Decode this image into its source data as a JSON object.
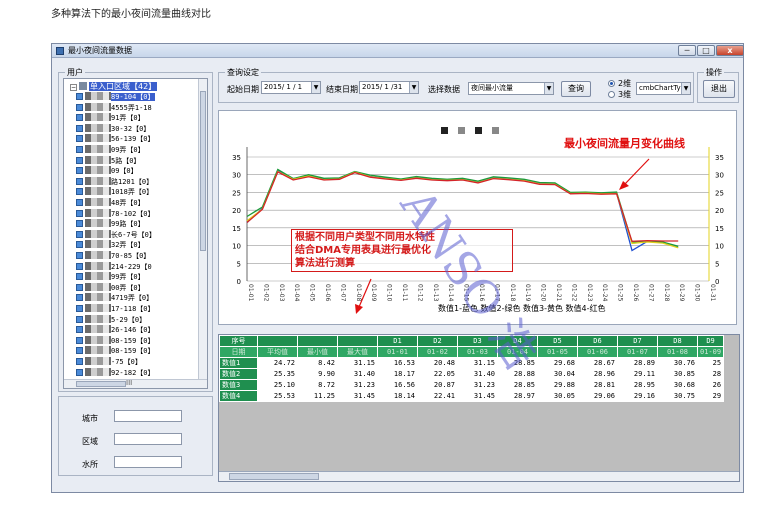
{
  "page_caption": "多种算法下的最小夜间流量曲线对比",
  "window": {
    "title": "最小夜间流量数据",
    "min_glyph": "─",
    "max_glyph": "□",
    "close_glyph": "x"
  },
  "users_panel": {
    "label": "用户",
    "root_expander": "−",
    "root_label": "单入口区域【42】",
    "items": [
      "89-104【0】",
      "4555弄1-18",
      "91弄【0】",
      "30-32【0】",
      "56-139【0】",
      "09弄【0】",
      "5路【0】",
      "09【0】",
      "路1201【0】",
      "1018弄【0】",
      "48弄【0】",
      "78-102【0】",
      "99路【0】",
      "长6-7号【0】",
      "32弄【0】",
      "70-85【0】",
      "214-229【0",
      "99弄【0】",
      "00弄【0】",
      "4719弄【0】",
      "17-118【0】",
      "5-29【0】",
      "26-146【0】",
      "08-159【0】",
      "08-159【0】",
      "-75【0】",
      "92-182【0】"
    ],
    "hscroll_glyph": "III"
  },
  "side_fields": [
    {
      "label": "城市",
      "value": ""
    },
    {
      "label": "区域",
      "value": ""
    },
    {
      "label": "水所",
      "value": ""
    }
  ],
  "query_settings": {
    "label": "查询设定",
    "start_date_label": "起始日期",
    "start_date": "2015/ 1 / 1",
    "end_date_label": "结束日期",
    "end_date": "2015/ 1 /31",
    "select_data_label": "选择数据",
    "select_data_value": "夜间最小流量",
    "query_button": "查询",
    "radio_2d": "2维",
    "radio_3d": "3维",
    "chart_type_value": "cmbChartTy"
  },
  "actions": {
    "label": "操作",
    "exit_button": "退出"
  },
  "chart_annotations": {
    "top_right_note": "最小夜间流量月变化曲线",
    "center_note_lines": [
      "根据不同用户类型不同用水特性",
      "结合DMA专用表具进行最优化",
      "算法进行测算"
    ]
  },
  "watermark_text": "ANSO 浩",
  "chart_data": {
    "type": "line",
    "title": "",
    "xlabel": "数值1-蓝色 数值2-绿色 数值3-黄色 数值4-红色",
    "ylabel": "",
    "ylim": [
      0,
      35
    ],
    "y_ticks": [
      0,
      5,
      10,
      15,
      20,
      25,
      30,
      35
    ],
    "x": [
      "01-01",
      "01-02",
      "01-03",
      "01-04",
      "01-05",
      "01-06",
      "01-07",
      "01-08",
      "01-09",
      "01-10",
      "01-11",
      "01-12",
      "01-13",
      "01-14",
      "01-15",
      "01-16",
      "01-17",
      "01-18",
      "01-19",
      "01-20",
      "01-21",
      "01-22",
      "01-23",
      "01-24",
      "01-25",
      "01-26",
      "01-27",
      "01-28",
      "01-29",
      "01-30",
      "01-31"
    ],
    "grid": true,
    "series": [
      {
        "name": "数值1",
        "color": "#1f4fd1",
        "values": [
          16.5,
          20.5,
          31.2,
          28.9,
          29.7,
          28.7,
          28.9,
          30.8,
          29.5,
          29.0,
          28.6,
          29.2,
          28.8,
          28.5,
          28.7,
          27.9,
          29.1,
          28.8,
          28.4,
          27.5,
          27.4,
          24.8,
          24.9,
          24.7,
          24.8,
          8.6,
          11.2,
          10.8,
          9.5,
          null,
          null
        ]
      },
      {
        "name": "数值2",
        "color": "#1c9b3a",
        "values": [
          18.2,
          20.9,
          31.5,
          28.9,
          30.0,
          29.0,
          29.1,
          30.9,
          29.9,
          29.3,
          28.8,
          29.5,
          29.0,
          28.7,
          29.0,
          28.2,
          29.4,
          29.1,
          28.7,
          27.8,
          27.7,
          25.0,
          25.1,
          24.9,
          25.1,
          11.0,
          11.3,
          11.0,
          9.8,
          null,
          null
        ]
      },
      {
        "name": "数值3",
        "color": "#e0d21a",
        "values": [
          17.0,
          20.3,
          30.9,
          28.7,
          29.6,
          28.6,
          28.8,
          30.7,
          29.4,
          28.9,
          28.5,
          29.1,
          28.6,
          28.4,
          28.6,
          27.8,
          29.0,
          28.7,
          28.3,
          27.4,
          27.3,
          24.7,
          24.8,
          24.6,
          24.7,
          10.6,
          11.0,
          10.7,
          9.4,
          null,
          null
        ]
      },
      {
        "name": "数值4",
        "color": "#d4242a",
        "values": [
          16.5,
          20.2,
          30.8,
          28.5,
          29.4,
          28.5,
          28.7,
          30.6,
          29.3,
          28.8,
          28.4,
          29.0,
          28.5,
          28.3,
          28.5,
          27.7,
          28.9,
          28.6,
          28.2,
          27.3,
          27.2,
          24.6,
          24.7,
          24.5,
          24.6,
          11.2,
          11.4,
          11.3,
          11.3,
          null,
          null
        ]
      }
    ],
    "legend_blocks": 4
  },
  "data_grid": {
    "header": [
      "序号",
      "",
      "",
      "",
      "D1",
      "D2",
      "D3",
      "D4",
      "D5",
      "D6",
      "D7",
      "D8",
      "D9"
    ],
    "subheader": [
      "日期",
      "平均值",
      "最小值",
      "最大值",
      "01-01",
      "01-02",
      "01-03",
      "01-04",
      "01-05",
      "01-06",
      "01-07",
      "01-08",
      "01-09"
    ],
    "rows": [
      {
        "name": "数值1",
        "cells": [
          "24.72",
          "8.42",
          "31.15",
          "16.53",
          "20.48",
          "31.15",
          "28.85",
          "29.68",
          "28.67",
          "28.89",
          "30.76",
          "25"
        ]
      },
      {
        "name": "数值2",
        "cells": [
          "25.35",
          "9.90",
          "31.40",
          "18.17",
          "22.05",
          "31.40",
          "28.88",
          "30.04",
          "28.96",
          "29.11",
          "30.85",
          "28"
        ]
      },
      {
        "name": "数值3",
        "cells": [
          "25.10",
          "8.72",
          "31.23",
          "16.56",
          "20.87",
          "31.23",
          "28.85",
          "29.88",
          "28.81",
          "28.95",
          "30.68",
          "26"
        ]
      },
      {
        "name": "数值4",
        "cells": [
          "25.53",
          "11.25",
          "31.45",
          "18.14",
          "22.41",
          "31.45",
          "28.97",
          "30.05",
          "29.06",
          "29.16",
          "30.75",
          "29"
        ]
      }
    ]
  }
}
